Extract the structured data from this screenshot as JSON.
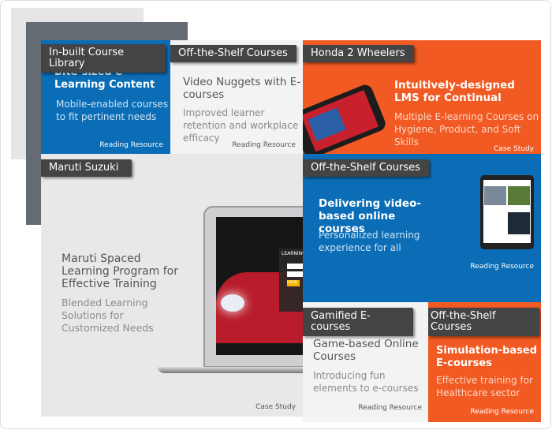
{
  "tiles": [
    {
      "tag": "In-built Course Library",
      "title": "Bite-sized e-Learning Content",
      "desc": "Mobile-enabled courses to fit pertinent needs",
      "link": "Reading Resource",
      "color": "#0a6db6"
    },
    {
      "tag": "Off-the-Shelf Courses",
      "title": "Video Nuggets with E-courses",
      "desc": "Improved learner retention and workplace efficacy",
      "link": "Reading Resource",
      "color": "#f3f3f3"
    },
    {
      "tag": "Honda 2 Wheelers",
      "title": "Intuitively-designed LMS for Continual",
      "desc": "Multiple E-learning Courses on Hygiene, Product, and Soft Skills",
      "link": "Case Study",
      "color": "#f15a22"
    },
    {
      "tag": "Maruti Suzuki",
      "title": "Maruti Spaced Learning Program for Effective Training",
      "desc": "Blended Learning Solutions for Customized Needs",
      "link": "Case Study",
      "color": "#e8e8e8"
    },
    {
      "tag": "Off-the-Shelf Courses",
      "title": "Delivering video-based online courses",
      "desc": "Personalized learning experience for all",
      "link": "Reading Resource",
      "color": "#0a6db6"
    },
    {
      "tag": "Gamified E-courses",
      "title": "Game-based Online Courses",
      "desc": "Introducing fun elements to e-courses",
      "link": "Reading Resource",
      "color": "#f3f3f3"
    },
    {
      "tag": "Off-the-Shelf Courses",
      "title": "Simulation-based E-courses",
      "desc": "Effective training for Healthcare sector",
      "link": "Reading Resource",
      "color": "#f15a22"
    }
  ],
  "laptop_screen": {
    "heading": "LEARNING",
    "button": "LOGIN"
  }
}
